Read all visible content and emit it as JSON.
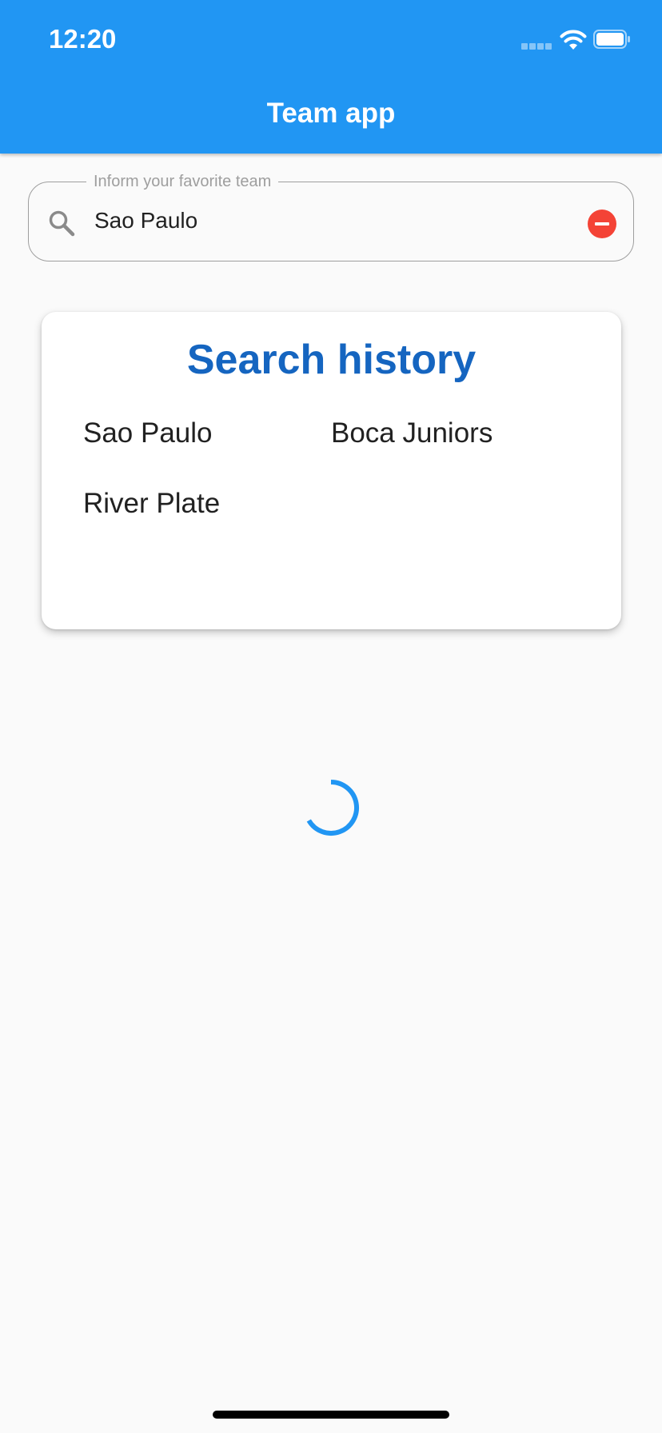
{
  "status_bar": {
    "time": "12:20"
  },
  "app_bar": {
    "title": "Team app"
  },
  "search": {
    "label": "Inform your favorite team",
    "value": "Sao Paulo"
  },
  "history": {
    "title": "Search history",
    "items": [
      "Sao Paulo",
      "Boca Juniors",
      "River Plate"
    ]
  },
  "colors": {
    "primary": "#2196f3",
    "history_title": "#1565c0",
    "clear_button": "#f44336",
    "background": "#fafafa"
  },
  "icons": {
    "search": "search-icon",
    "clear": "remove-circle-icon",
    "wifi": "wifi-icon",
    "battery": "battery-icon",
    "signal": "cellular-signal-icon"
  }
}
